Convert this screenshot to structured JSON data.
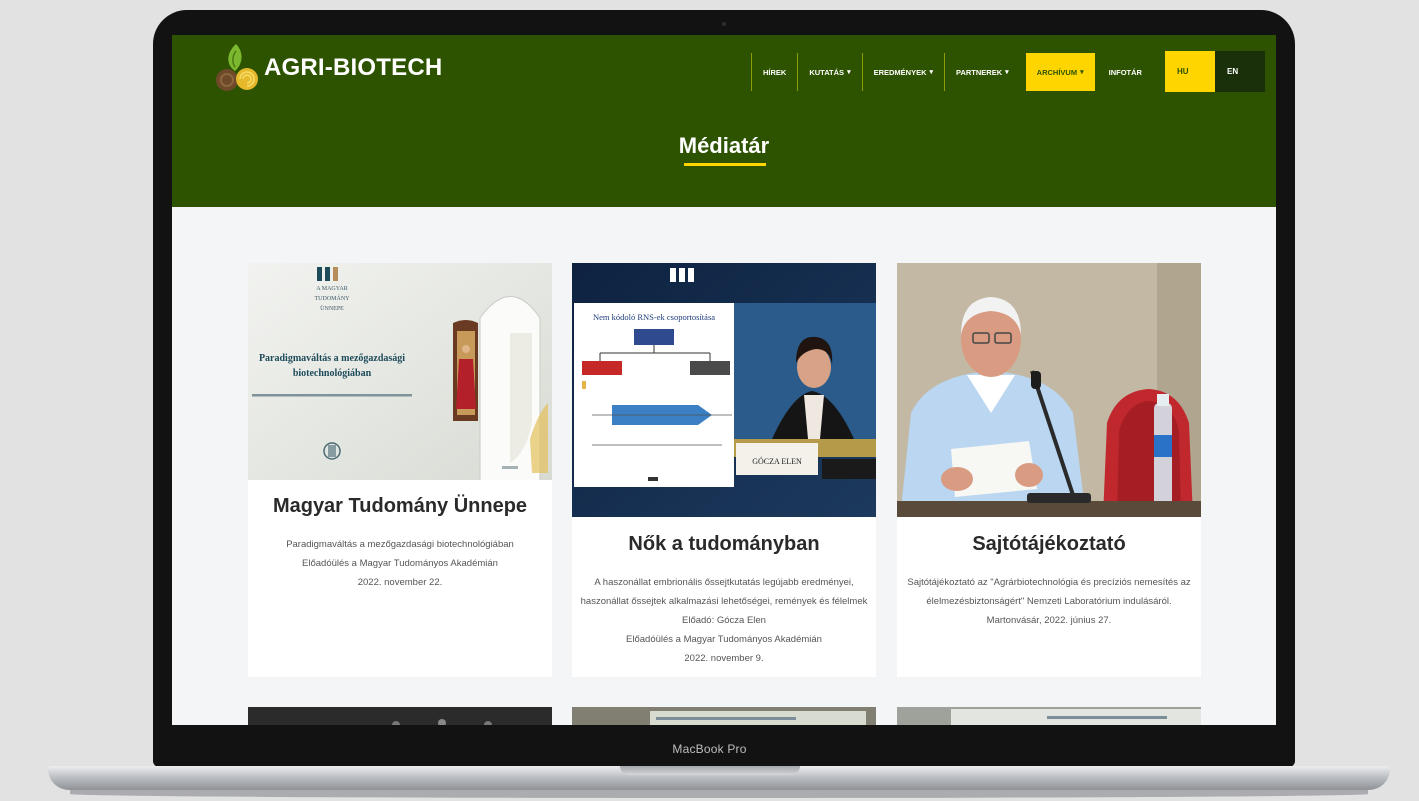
{
  "device": {
    "label": "MacBook Pro"
  },
  "site": {
    "logo_text": "AGRI-BIOTECH"
  },
  "nav": {
    "items": [
      {
        "label": "HÍREK",
        "has_dropdown": false
      },
      {
        "label": "KUTATÁS",
        "has_dropdown": true
      },
      {
        "label": "EREDMÉNYEK",
        "has_dropdown": true
      },
      {
        "label": "PARTNEREK",
        "has_dropdown": true
      },
      {
        "label": "ARCHÍVUM",
        "has_dropdown": true,
        "active": true
      },
      {
        "label": "INFOTÁR",
        "has_dropdown": false
      }
    ],
    "chevron": "▾",
    "languages": [
      "HU",
      "EN"
    ],
    "active_language": "HU"
  },
  "page": {
    "title": "Médiatár"
  },
  "colors": {
    "header_bg": "#2d5300",
    "accent_yellow": "#ffd500"
  },
  "cards": [
    {
      "title": "Magyar Tudomány Ünnepe",
      "description_lines": [
        "Paradigmaváltás a mezőgazdasági biotechnológiában",
        "Előadóülés a Magyar Tudományos Akadémián",
        "2022. november 22."
      ],
      "image": {
        "kicker_lines": [
          "A MAGYAR",
          "TUDOMÁNY",
          "ÜNNEPE"
        ],
        "headline_lines": [
          "Paradigmaváltás a mezőgazdasági",
          "biotechnológiában"
        ]
      }
    },
    {
      "title": "Nők a tudományban",
      "description_lines": [
        "A haszonállat embrionális őssejtkutatás legújabb eredményei,",
        "haszonállat őssejtek alkalmazási lehetőségei, remények és félelmek",
        "Előadó: Gócza Elen",
        "Előadóülés a Magyar Tudományos Akadémián",
        "2022. november 9."
      ],
      "image": {
        "slide_title": "Nem kódoló RNS-ek csoportosítása",
        "nameplate": "GÓCZA ELEN"
      }
    },
    {
      "title": "Sajtótájékoztató",
      "description_lines": [
        "Sajtótájékoztató az \"Agrárbiotechnológia és precíziós nemesítés az",
        "élelmezésbiztonságért\" Nemzeti Laboratórium indulásáról.",
        "Martonvásár, 2022. június 27."
      ]
    }
  ]
}
